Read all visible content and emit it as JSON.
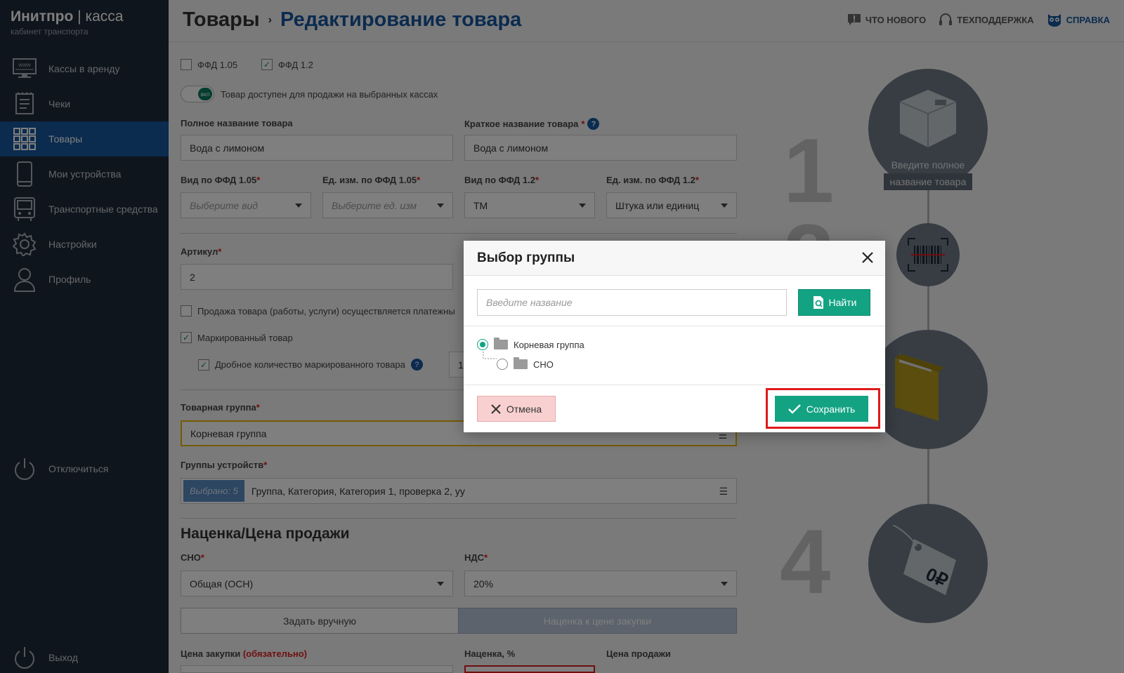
{
  "app": {
    "brand": "Инитпро",
    "brand_sep": "|",
    "brand_suffix": "касса",
    "subtitle": "кабинет транспорта"
  },
  "sidebar": {
    "items": [
      {
        "label": "Кассы в аренду",
        "icon": "monitor-www-icon"
      },
      {
        "label": "Чеки",
        "icon": "receipt-icon"
      },
      {
        "label": "Товары",
        "icon": "grid-icon",
        "active": true
      },
      {
        "label": "Мои устройства",
        "icon": "phone-icon"
      },
      {
        "label": "Транспортные средства",
        "icon": "bus-icon"
      },
      {
        "label": "Настройки",
        "icon": "gear-icon"
      },
      {
        "label": "Профиль",
        "icon": "user-icon"
      }
    ],
    "disconnect": "Отключиться",
    "logout": "Выход"
  },
  "header": {
    "crumb_root": "Товары",
    "crumb_current": "Редактирование товара",
    "links": {
      "whats_new": "ЧТО НОВОГО",
      "support": "ТЕХПОДДЕРЖКА",
      "help": "СПРАВКА"
    }
  },
  "form": {
    "ffd105": "ФФД 1.05",
    "ffd12": "ФФД 1.2",
    "toggle_label": "вкл",
    "available_text": "Товар доступен для продажи на выбранных кассах",
    "full_name_label": "Полное название товара",
    "full_name_value": "Вода с лимоном",
    "short_name_label": "Краткое название товара",
    "short_name_value": "Вода с лимоном",
    "type105_label": "Вид по ФФД 1.05",
    "type105_placeholder": "Выберите вид",
    "unit105_label": "Ед. изм. по ФФД 1.05",
    "unit105_placeholder": "Выберите ед. изм",
    "type12_label": "Вид по ФФД 1.2",
    "type12_value": "ТМ",
    "unit12_label": "Ед. изм. по ФФД 1.2",
    "unit12_value": "Штука или единиц",
    "article_label": "Артикул",
    "article_value": "2",
    "agent_text": "Продажа товара (работы, услуги) осуществляется платежны",
    "marked_text": "Маркированный товар",
    "fraction_text": "Дробное количество маркированного товара",
    "fraction_value": "1",
    "group_label": "Товарная группа",
    "group_value": "Корневая группа",
    "device_groups_label": "Группы устройств",
    "device_groups_badge": "Выбрано: 5",
    "device_groups_value": "Группа, Категория, Категория 1, проверка 2, уу",
    "section_price": "Наценка/Цена продажи",
    "sno_label": "СНО",
    "sno_value": "Общая (ОСН)",
    "vat_label": "НДС",
    "vat_value": "20%",
    "tab_manual": "Задать вручную",
    "tab_markup": "Наценка к цене закупки",
    "purchase_label": "Цена закупки",
    "purchase_required": "(обязательно)",
    "markup_label": "Наценка, %",
    "sale_label": "Цена продажи"
  },
  "illustration": {
    "step1_text_line1": "Введите полное",
    "step1_text_line2": "название товара",
    "num1": "1",
    "num2": "2",
    "num4": "4",
    "price_tag": "0₽"
  },
  "modal": {
    "title": "Выбор группы",
    "search_placeholder": "Введите название",
    "find_button": "Найти",
    "tree": [
      {
        "label": "Корневая группа",
        "selected": true
      },
      {
        "label": "СНО",
        "selected": false
      }
    ],
    "cancel_button": "Отмена",
    "save_button": "Сохранить",
    "colors": {
      "accent": "#13a383",
      "highlight": "#e01a1a",
      "cancel_bg": "#f8d0d0"
    }
  }
}
